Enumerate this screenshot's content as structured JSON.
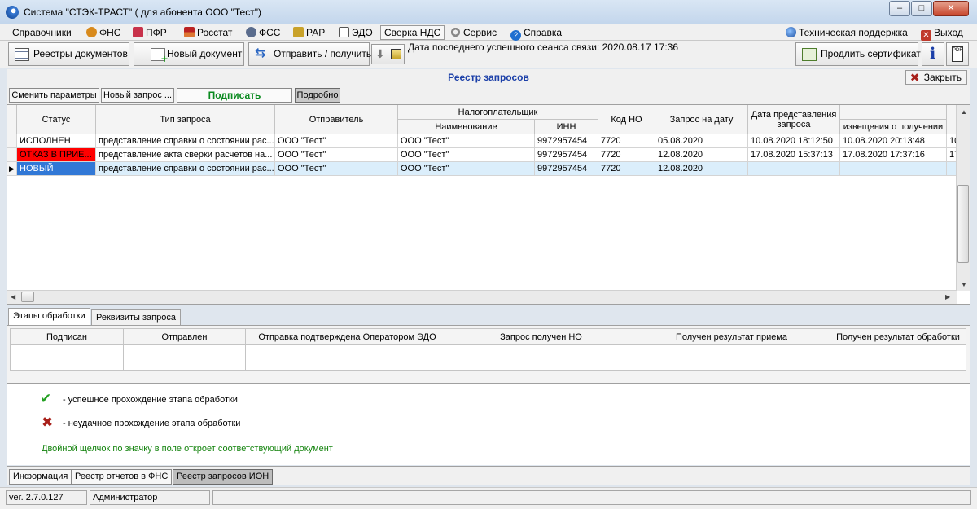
{
  "window": {
    "title": "Система \"СТЭК-ТРАСТ\" ( для абонента ООО \"Тест\")",
    "minimize": "–",
    "restore": "□",
    "close": "✕"
  },
  "menu": {
    "items": [
      {
        "label": "Справочники",
        "icon": null
      },
      {
        "label": "ФНС",
        "icon": "fns-icon"
      },
      {
        "label": "ПФР",
        "icon": "pfr-icon"
      },
      {
        "label": "Росстат",
        "icon": "rosstat-icon"
      },
      {
        "label": "ФСС",
        "icon": "fss-icon"
      },
      {
        "label": "РАР",
        "icon": "rar-icon"
      },
      {
        "label": "ЭДО",
        "icon": "edo-icon"
      },
      {
        "label": "Сверка НДС",
        "icon": null
      },
      {
        "label": "Сервис",
        "icon": "gear-icon"
      },
      {
        "label": "Справка",
        "icon": "help-icon"
      }
    ],
    "support": "Техническая поддержка",
    "exit": "Выход"
  },
  "toolbar": {
    "registries": "Реестры документов",
    "new_doc": "Новый документ",
    "send_receive": "Отправить / получить",
    "last_session": "Дата последнего успешного сеанса связи: 2020.08.17 17:36",
    "renew_cert": "Продлить сертификат"
  },
  "registry": {
    "title": "Реестр запросов",
    "close": "Закрыть"
  },
  "actions": {
    "change_params": "Сменить параметры",
    "new_request": "Новый запрос ...",
    "sign": "Подписать",
    "details": "Подробно"
  },
  "grid": {
    "headers": {
      "status": "Статус",
      "type": "Тип запроса",
      "sender": "Отправитель",
      "taxpayer": "Налогоплательщик",
      "name": "Наименование",
      "inn": "ИНН",
      "code": "Код НО",
      "date": "Запрос на дату",
      "submitted": "Дата представления запроса",
      "notice": "извещения о получении"
    },
    "rows": [
      {
        "status": "ИСПОЛНЕН",
        "type": "представление справки о состоянии рас...",
        "sender": "ООО \"Тест\"",
        "name": "ООО \"Тест\"",
        "inn": "9972957454",
        "code": "7720",
        "date": "05.08.2020",
        "submitted": "10.08.2020 18:12:50",
        "notice": "10.08.2020 20:13:48",
        "extra": "10"
      },
      {
        "status": "ОТКАЗ В ПРИЕ...",
        "type": "представление акта сверки расчетов на...",
        "sender": "ООО \"Тест\"",
        "name": "ООО \"Тест\"",
        "inn": "9972957454",
        "code": "7720",
        "date": "12.08.2020",
        "submitted": "17.08.2020 15:37:13",
        "notice": "17.08.2020 17:37:16",
        "extra": "17"
      },
      {
        "status": "НОВЫЙ",
        "type": "представление справки о состоянии рас...",
        "sender": "ООО \"Тест\"",
        "name": "ООО \"Тест\"",
        "inn": "9972957454",
        "code": "7720",
        "date": "12.08.2020",
        "submitted": "",
        "notice": "",
        "extra": ""
      }
    ],
    "colors": {
      "refused": "#ff0000",
      "new": "#3178d6",
      "selected_row": "#dbeefb"
    }
  },
  "detail_tabs": {
    "stages": "Этапы обработки",
    "requisites": "Реквизиты запроса"
  },
  "stages": {
    "headers": [
      "Подписан",
      "Отправлен",
      "Отправка подтверждена Оператором ЭДО",
      "Запрос получен НО",
      "Получен результат приема",
      "Получен результат обработки"
    ]
  },
  "legend": {
    "success": "- успешное прохождение этапа обработки",
    "fail": "- неудачное прохождение этапа обработки",
    "hint": "Двойной щелчок по значку в поле откроет соответствующий документ"
  },
  "bottom_tabs": [
    "Информация",
    "Реестр отчетов в ФНС",
    "Реестр запросов ИОН"
  ],
  "status": {
    "version": "ver. 2.7.0.127",
    "user": "Администратор"
  }
}
